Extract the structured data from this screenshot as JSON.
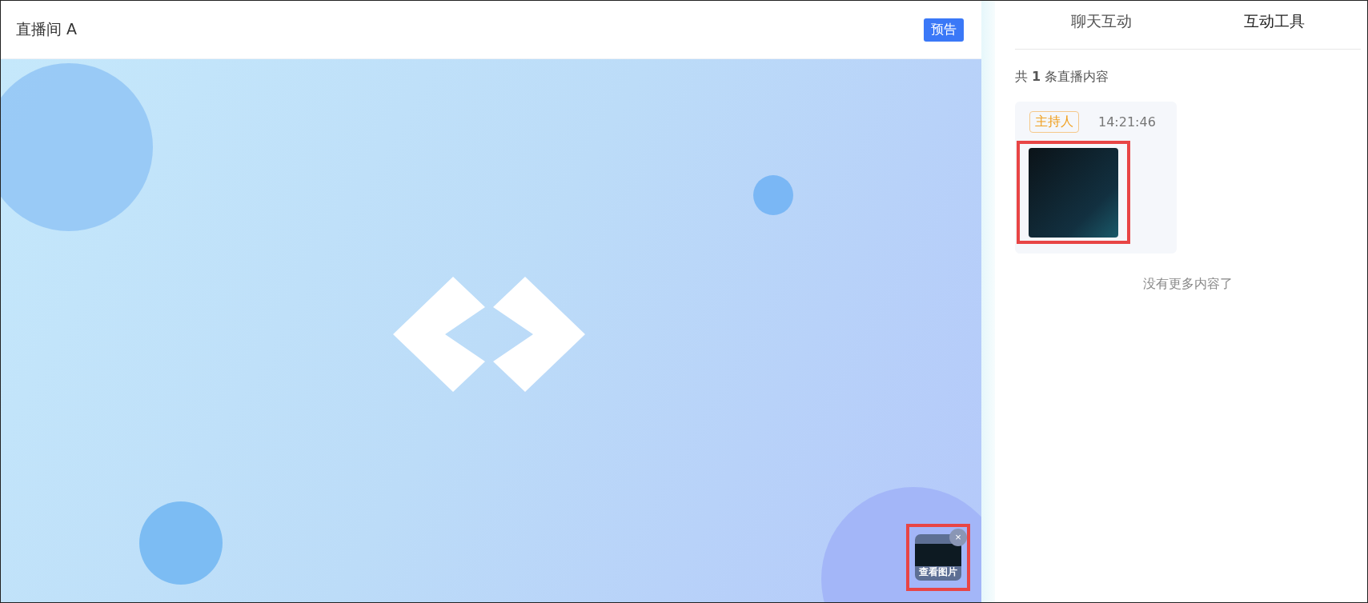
{
  "room": {
    "title": "直播间 A",
    "badge": "预告"
  },
  "preview": {
    "caption": "查看图片",
    "close": "×"
  },
  "tabs": [
    {
      "label": "聊天互动",
      "selected": false
    },
    {
      "label": "互动工具",
      "selected": true
    }
  ],
  "summary": "共 **1** 条直播内容",
  "messages": [
    {
      "role": "主持人",
      "time": "14:21:46",
      "highlighted": true
    }
  ],
  "end_note": "没有更多内容了"
}
